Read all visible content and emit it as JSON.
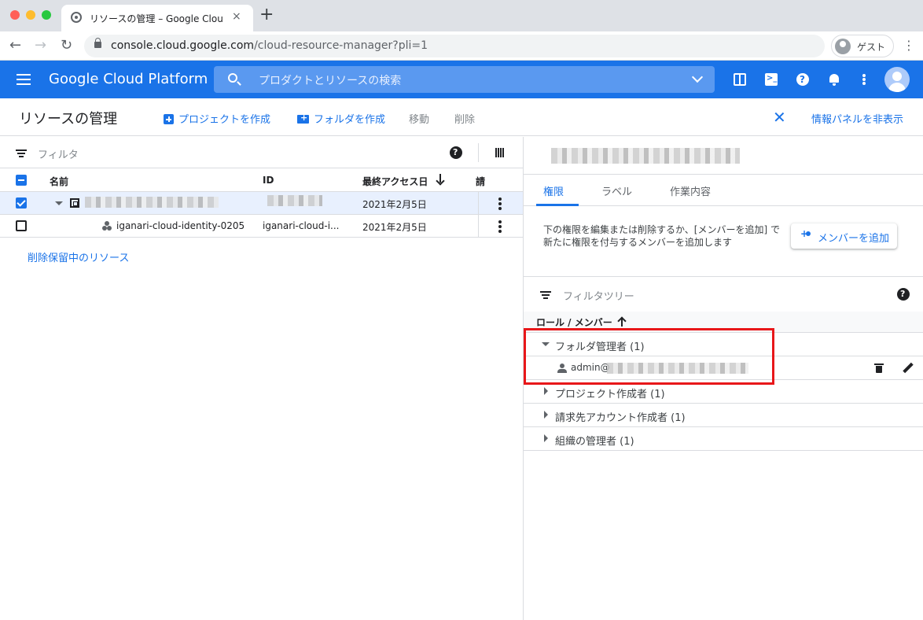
{
  "browser": {
    "tab_title": "リソースの管理 – Google Cloud P",
    "tab_close": "×",
    "new_tab": "+",
    "back": "←",
    "forward": "→",
    "reload": "↻",
    "url_host": "console.cloud.google.com",
    "url_path": "/cloud-resource-manager?pli=1",
    "profile_label": "ゲスト",
    "menu": "⋮"
  },
  "gcp_header": {
    "title": "Google Cloud Platform",
    "search_placeholder": "プロダクトとリソースの検索"
  },
  "actionbar": {
    "page_title": "リソースの管理",
    "create_project": "プロジェクトを作成",
    "create_folder": "フォルダを作成",
    "move": "移動",
    "delete": "削除",
    "close": "✕",
    "hide_info_panel": "情報パネルを非表示"
  },
  "left_panel": {
    "filter_placeholder": "フィルタ",
    "columns": {
      "name": "名前",
      "id": "ID",
      "last_access": "最終アクセス日",
      "truncated": "請"
    },
    "rows": [
      {
        "name": "",
        "id": "",
        "last_access": "2021年2月5日",
        "checked": true,
        "type": "organization"
      },
      {
        "name": "iganari-cloud-identity-0205",
        "id": "iganari-cloud-i...",
        "last_access": "2021年2月5日",
        "checked": false,
        "type": "identity"
      }
    ],
    "pending_deletion_link": "削除保留中のリソース"
  },
  "right_panel": {
    "tabs": [
      "権限",
      "ラベル",
      "作業内容"
    ],
    "active_tab": "権限",
    "info_text": "下の権限を編集または削除するか、[メンバーを追加] で新たに権限を付与するメンバーを追加します",
    "add_member_label": "メンバーを追加",
    "tree_filter_placeholder": "フィルタツリー",
    "role_member_header": "ロール / メンバー",
    "roles": [
      {
        "label": "フォルダ管理者 (1)",
        "expanded": true
      },
      {
        "label": "プロジェクト作成者 (1)",
        "expanded": false
      },
      {
        "label": "請求先アカウント作成者 (1)",
        "expanded": false
      },
      {
        "label": "組織の管理者 (1)",
        "expanded": false
      }
    ],
    "member_email": "admin@"
  },
  "colors": {
    "accent": "#1a73e8",
    "highlight": "#e8171a"
  }
}
